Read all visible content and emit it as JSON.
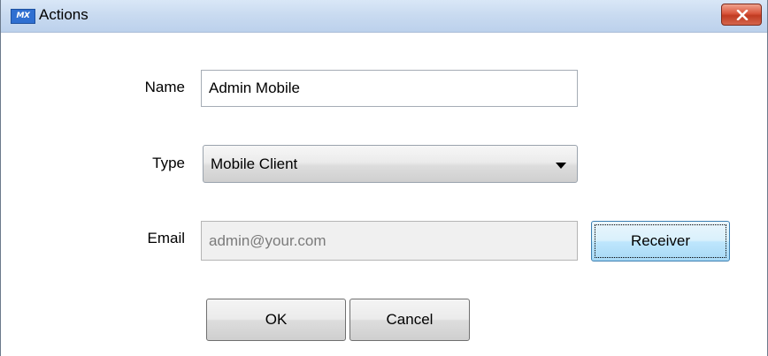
{
  "window": {
    "title": "Actions",
    "app_icon_text": "MX"
  },
  "form": {
    "name_label": "Name",
    "name_value": "Admin Mobile",
    "type_label": "Type",
    "type_value": "Mobile Client",
    "email_label": "Email",
    "email_placeholder": "admin@your.com"
  },
  "buttons": {
    "receiver": "Receiver",
    "ok": "OK",
    "cancel": "Cancel"
  },
  "colors": {
    "title_bar": "#c8daf0",
    "close_button": "#c94a2f",
    "focused_button": "#bee6fd"
  }
}
